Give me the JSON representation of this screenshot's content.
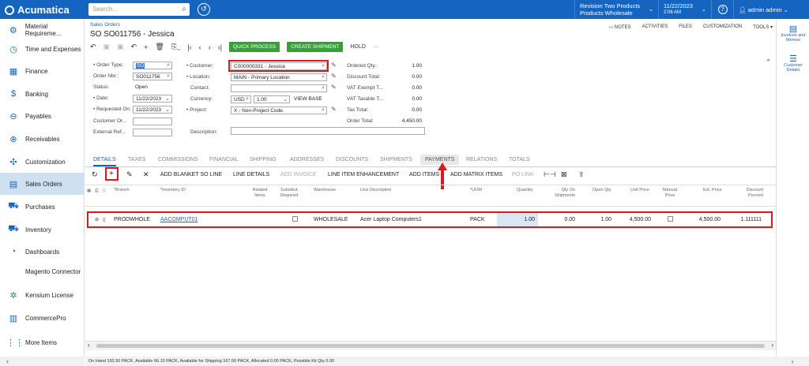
{
  "topbar": {
    "logo": "Acumatica",
    "search_placeholder": "Search...",
    "company_line1": "Revision Two Products",
    "company_line2": "Products Wholesale",
    "date_line1": "11/22/2023",
    "date_line2": "2:06 AM",
    "help": "?",
    "user": "admin admin"
  },
  "sidebar": {
    "items": [
      {
        "label": "Material Requireme...",
        "icon": "gear-icon"
      },
      {
        "label": "Time and Expenses",
        "icon": "clock-icon"
      },
      {
        "label": "Finance",
        "icon": "calculator-icon"
      },
      {
        "label": "Banking",
        "icon": "dollar-icon"
      },
      {
        "label": "Payables",
        "icon": "minus-circle-icon"
      },
      {
        "label": "Receivables",
        "icon": "plus-circle-icon"
      },
      {
        "label": "Customization",
        "icon": "puzzle-icon"
      },
      {
        "label": "Sales Orders",
        "icon": "document-icon"
      },
      {
        "label": "Purchases",
        "icon": "cart-icon"
      },
      {
        "label": "Inventory",
        "icon": "truck-icon"
      },
      {
        "label": "Dashboards",
        "icon": "gauge-icon"
      },
      {
        "label": "Magento Connector",
        "icon": ""
      },
      {
        "label": "Kensium License",
        "icon": "star-icon"
      },
      {
        "label": "CommercePro",
        "icon": "building-icon"
      },
      {
        "label": "More Items",
        "icon": "grid-icon"
      }
    ],
    "collapse": "‹"
  },
  "right_panel": {
    "item1": "Invoices and Memos",
    "item2": "Customer Details"
  },
  "page": {
    "breadcrumb": "Sales Orders",
    "title": "SO SO011756 - Jessica",
    "top_actions": [
      "NOTES",
      "ACTIVITIES",
      "FILES",
      "CUSTOMIZATION",
      "TOOLS ▾"
    ],
    "quick_process": "QUICK PROCESS",
    "create_shipment": "CREATE SHIPMENT",
    "hold": "HOLD",
    "more": "···"
  },
  "form": {
    "order_type_label": "• Order Type:",
    "order_type": "SO",
    "order_nbr_label": "Order Nbr.:",
    "order_nbr": "SO011756",
    "status_label": "Status:",
    "status": "Open",
    "date_label": "• Date:",
    "date": "11/22/2023",
    "requested_on_label": "• Requested On:",
    "requested_on": "11/22/2023",
    "customer_ord_label": "Customer Or...",
    "external_ref_label": "External Ref...",
    "customer_label": "• Customer:",
    "customer": "C000000331 - Jessica",
    "location_label": "• Location:",
    "location": "MAIN - Primary Location",
    "contact_label": "Contact:",
    "currency_label": "Currency:",
    "currency": "USD",
    "currency_rate": "1.00",
    "view_base": "VIEW BASE",
    "project_label": "• Project:",
    "project": "X - Non-Project Code.",
    "description_label": "Description:",
    "ordered_qty_label": "Ordered Qty.:",
    "ordered_qty": "1.00",
    "discount_total_label": "Discount Total:",
    "discount_total": "0.00",
    "vat_exempt_label": "VAT Exempt T...",
    "vat_exempt": "0.00",
    "vat_taxable_label": "VAT Taxable T...",
    "vat_taxable": "0.00",
    "tax_total_label": "Tax Total:",
    "tax_total": "0.00",
    "order_total_label": "Order Total:",
    "order_total": "4,450.00"
  },
  "tabs": [
    "DETAILS",
    "TAXES",
    "COMMISSIONS",
    "FINANCIAL",
    "SHIPPING",
    "ADDRESSES",
    "DISCOUNTS",
    "SHIPMENTS",
    "PAYMENTS",
    "RELATIONS",
    "TOTALS"
  ],
  "grid_toolbar": [
    "ADD BLANKET SO LINE",
    "LINE DETAILS",
    "ADD INVOICE",
    "LINE ITEM ENHANCEMENT",
    "ADD ITEMS",
    "ADD MATRIX ITEMS",
    "PO LINK"
  ],
  "grid": {
    "headers": [
      "*Branch",
      "*Inventory ID",
      "Related Items",
      "Substitut. Required",
      "Warehouse",
      "Line Description",
      "*UOM",
      "Quantity",
      "Qty On Shipments",
      "Open Qty",
      "Unit Price",
      "Manual Price",
      "Ext. Price",
      "Discount Percent"
    ],
    "row": {
      "branch": "PRODWHOLE",
      "inventory_id": "AACOMPUT01",
      "warehouse": "WHOLESALE",
      "line_description": "Acer Laptop Computers1",
      "uom": "PACK",
      "quantity": "1.00",
      "qty_on_shipments": "0.00",
      "open_qty": "1.00",
      "unit_price": "4,500.00",
      "ext_price": "4,500.00",
      "discount_percent": "1.111111"
    }
  },
  "status_bar": "On Hand 192.50 PACK, Available 66.10 PACK, Available for Shipping 167.00 PACK, Allocated 0.00 PACK, Possible Kit Qty 0.00",
  "colors": {
    "brand": "#1565c0",
    "green": "#35a235",
    "red_box": "#e0161b"
  }
}
